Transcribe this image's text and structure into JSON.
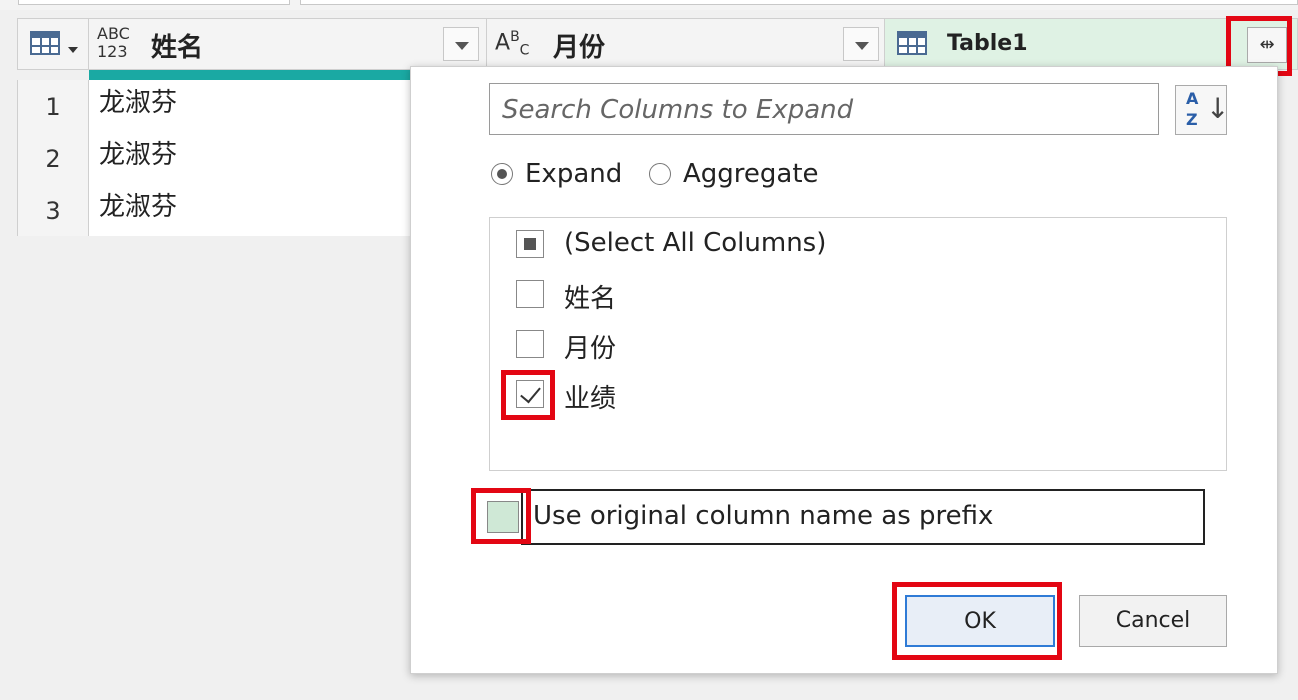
{
  "grid": {
    "columns": [
      {
        "type_icon": "ABC\n123",
        "name": "姓名"
      },
      {
        "type_icon": "ABC",
        "name": "月份"
      },
      {
        "type_icon": "table-icon",
        "name": "Table1"
      }
    ],
    "rows": [
      {
        "num": "1",
        "name": "龙淑芬"
      },
      {
        "num": "2",
        "name": "龙淑芬"
      },
      {
        "num": "3",
        "name": "龙淑芬"
      }
    ]
  },
  "popup": {
    "search_placeholder": "Search Columns to Expand",
    "sort_icon": "sort-az-icon",
    "radio_expand": "Expand",
    "radio_aggregate": "Aggregate",
    "selected_mode": "Expand",
    "columns": [
      {
        "label": "(Select All Columns)",
        "state": "partial"
      },
      {
        "label": "姓名",
        "state": "unchecked"
      },
      {
        "label": "月份",
        "state": "unchecked"
      },
      {
        "label": "业绩",
        "state": "checked"
      }
    ],
    "prefix_label": "Use original column name as prefix",
    "prefix_checked": false,
    "ok_label": "OK",
    "cancel_label": "Cancel"
  },
  "colors": {
    "highlight": "#e30613",
    "teal": "#1aa9a3",
    "table_header_bg": "#dff2e4"
  }
}
